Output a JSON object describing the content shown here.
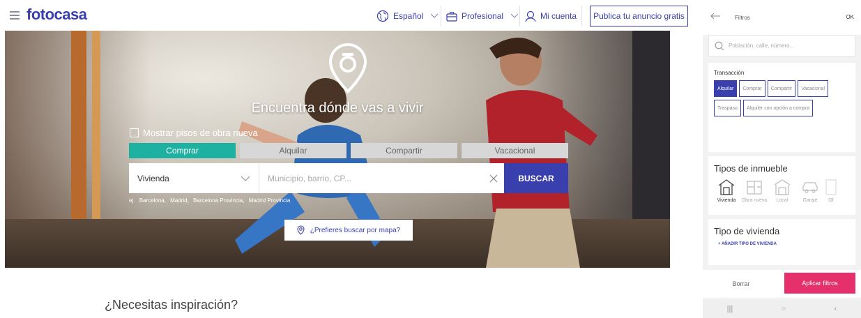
{
  "header": {
    "logo": "fotocasa",
    "language": "Español",
    "professional": "Profesional",
    "account": "Mi cuenta",
    "publish": "Publica tu anuncio gratis"
  },
  "hero": {
    "tagline": "Encuentra dónde vas a vivir",
    "new_build_checkbox": "Mostrar pisos de obra nueva",
    "tabs": [
      "Comprar",
      "Alquilar",
      "Compartir",
      "Vacacional"
    ],
    "active_tab": "Comprar",
    "property_select": "Vivienda",
    "location_placeholder": "Municipio, barrio, CP...",
    "search_button": "BUSCAR",
    "examples_prefix": "ej.",
    "examples": [
      "Barcelona,",
      "Madrid,",
      "Barcelona Provincia,",
      "Madrid Provincia"
    ],
    "map_button": "¿Prefieres buscar por mapa?"
  },
  "inspiration": {
    "heading": "¿Necesitas inspiración?"
  },
  "mobile": {
    "title": "Filtros",
    "ok": "OK",
    "search_placeholder": "Población, calle, número...",
    "transaction": {
      "title": "Transacción",
      "options": [
        "Alquilar",
        "Comprar",
        "Compartir",
        "Vacacional",
        "Traspaso",
        "Alquiler con opción a compra"
      ],
      "active": "Alquilar"
    },
    "property_types": {
      "title": "Tipos de inmueble",
      "items": [
        "Vivienda",
        "Obra nueva",
        "Local",
        "Garaje",
        "Of"
      ],
      "active": "Vivienda"
    },
    "housing_type": {
      "title": "Tipo de vivienda",
      "add_link": "+ AÑADIR TIPO DE VIVIENDA"
    },
    "footer": {
      "clear": "Borrar",
      "apply": "Aplicar filtros"
    },
    "system_bar": [
      "|||",
      "○",
      "‹"
    ]
  },
  "colors": {
    "brand": "#3a3fae",
    "teal": "#1eb1a2",
    "pink": "#e5306b"
  }
}
